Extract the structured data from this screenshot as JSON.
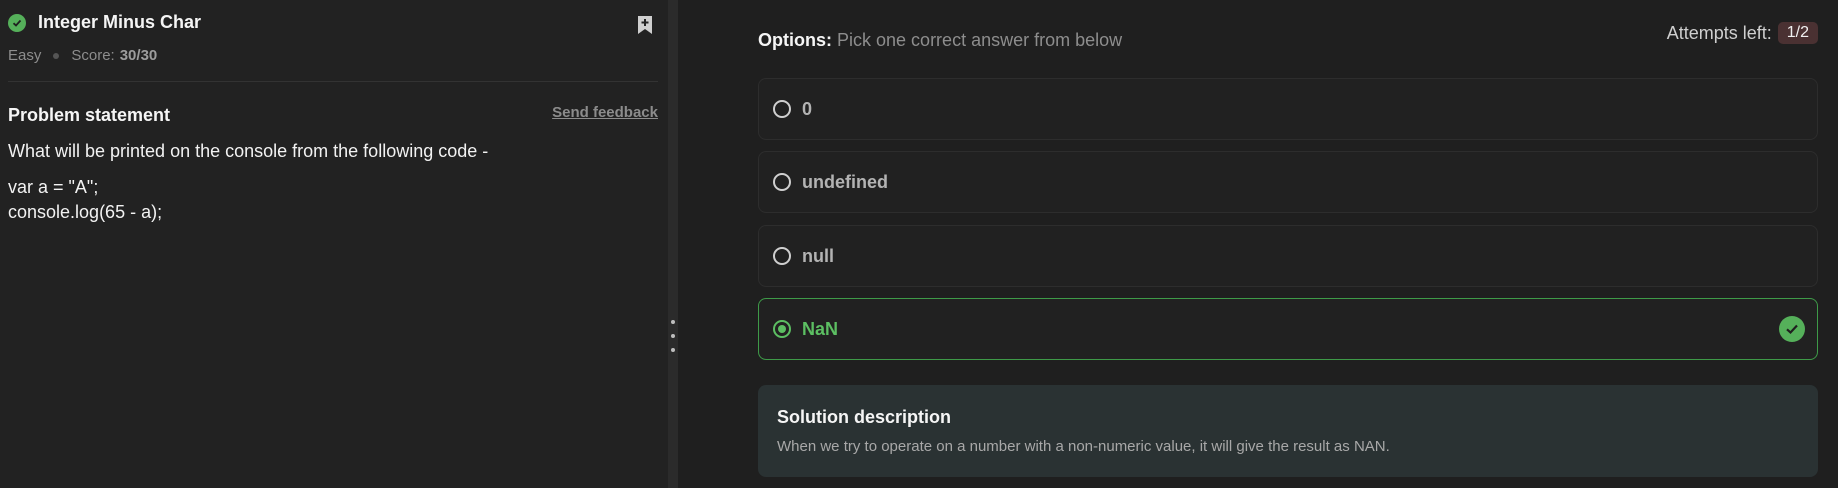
{
  "problem": {
    "title": "Integer Minus Char",
    "difficulty": "Easy",
    "score_label": "Score:",
    "score_value": "30/30",
    "statement_heading": "Problem statement",
    "feedback_link": "Send feedback",
    "question": "What will be printed on the console from the following code -",
    "code": "var a = \"A\";\nconsole.log(65 - a);",
    "status_icon": "check-circle-icon",
    "bookmark_icon": "bookmark-add-icon"
  },
  "quiz": {
    "options_label": "Options:",
    "options_hint": "Pick one correct answer from below",
    "attempts_label": "Attempts left:",
    "attempts_value": "1/2",
    "options": [
      {
        "label": "0",
        "selected": false,
        "correct": false
      },
      {
        "label": "undefined",
        "selected": false,
        "correct": false
      },
      {
        "label": "null",
        "selected": false,
        "correct": false
      },
      {
        "label": "NaN",
        "selected": true,
        "correct": true
      }
    ],
    "solution_title": "Solution description",
    "solution_text": "When we try to operate on a number with a non-numeric value, it will give the result as NAN."
  },
  "colors": {
    "success": "#55b05a",
    "background": "#1f1f1f",
    "panel": "#222222",
    "solution_bg": "#2a3233"
  }
}
